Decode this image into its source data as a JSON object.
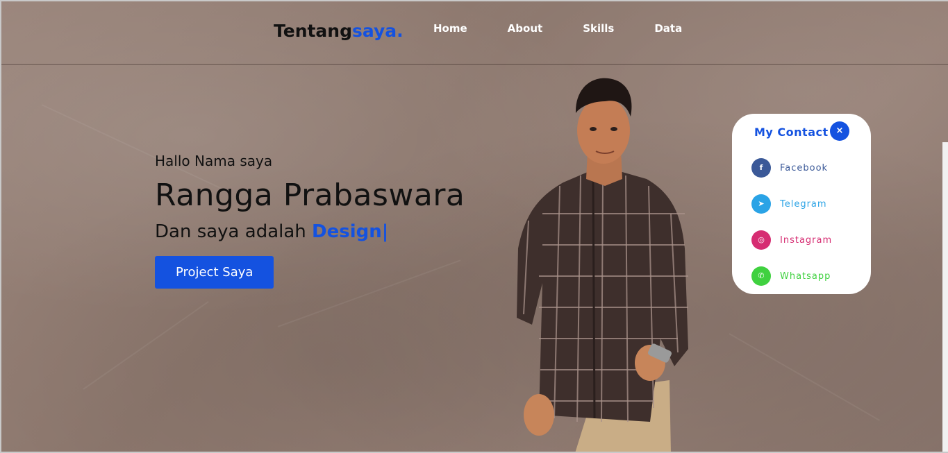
{
  "brand": {
    "name": "Tentang",
    "accent": "saya."
  },
  "nav": [
    "Home",
    "About",
    "Skills",
    "Data"
  ],
  "hero": {
    "greeting": "Hallo Nama saya",
    "name": "Rangga Prabaswara",
    "role_prefix": "Dan saya adalah ",
    "role_typed": "Design|",
    "button": "Project Saya"
  },
  "contact": {
    "title": "My Contact",
    "close_icon": "×",
    "items": [
      {
        "label": "Facebook",
        "icon": "facebook-icon",
        "glyph": "f",
        "color": "#3b5998"
      },
      {
        "label": "Telegram",
        "icon": "telegram-icon",
        "glyph": "➤",
        "color": "#2aa3e6"
      },
      {
        "label": "Instagram",
        "icon": "instagram-icon",
        "glyph": "◎",
        "color": "#d62d72"
      },
      {
        "label": "Whatsapp",
        "icon": "whatsapp-icon",
        "glyph": "✆",
        "color": "#3fd13f"
      }
    ]
  },
  "colors": {
    "accent": "#1452e0",
    "background": "#8f7a70"
  }
}
